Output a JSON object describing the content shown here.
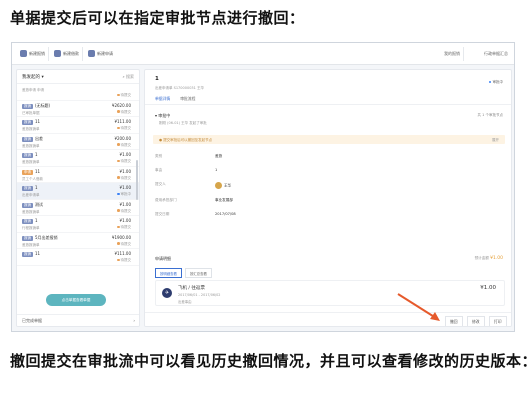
{
  "headings": {
    "top": "单据提交后可以在指定审批节点进行撤回：",
    "bottom": "撤回提交在审批流中可以看见历史撤回情况，并且可以查看修改的历史版本："
  },
  "topbar": {
    "buttons": [
      "新建报销",
      "新建借款",
      "新建申请"
    ],
    "right_items": [
      "我的报销",
      "行政单据汇总"
    ]
  },
  "left_panel": {
    "header": "我发起的",
    "search": "搜索",
    "rows": [
      {
        "badge": "",
        "title": "",
        "sub": "差旅申请 申请",
        "amount": "",
        "status": "待提交",
        "status_color": "orange"
      },
      {
        "badge": "报销",
        "title": "(无标题)",
        "sub": "已审批单据",
        "amount": "¥2620.00",
        "status": "待提交",
        "status_color": "orange"
      },
      {
        "badge": "报销",
        "title": "11",
        "sub": "差旅报销单",
        "amount": "¥111.00",
        "status": "待提交",
        "status_color": "orange"
      },
      {
        "badge": "报销",
        "title": "出差",
        "sub": "差旅报销单",
        "amount": "¥200.00",
        "status": "待提交",
        "status_color": "orange"
      },
      {
        "badge": "报销",
        "title": "1",
        "sub": "差旅报销单",
        "amount": "¥1.00",
        "status": "待提交",
        "status_color": "orange"
      },
      {
        "badge": "申请",
        "title": "11",
        "sub": "员工个人借款",
        "amount": "¥1.00",
        "status": "待提交",
        "status_color": "orange",
        "badge_color": "orange"
      },
      {
        "badge": "报销",
        "title": "1",
        "sub": "出差申请单",
        "amount": "¥1.00",
        "status": "审批中",
        "status_color": "blue",
        "selected": true
      },
      {
        "badge": "报销",
        "title": "测试",
        "sub": "差旅报销单",
        "amount": "¥1.00",
        "status": "待提交",
        "status_color": "orange"
      },
      {
        "badge": "报销",
        "title": "1",
        "sub": "行程报销单",
        "amount": "¥1.00",
        "status": "待提交",
        "status_color": "orange"
      },
      {
        "badge": "报销",
        "title": "5月出差报销",
        "sub": "差旅报销单",
        "amount": "¥1900.00",
        "status": "待提交",
        "status_color": "orange"
      },
      {
        "badge": "报销",
        "title": "11",
        "sub": "",
        "amount": "¥111.00",
        "status": "待提交",
        "status_color": "orange"
      }
    ],
    "footer": "已完成单据",
    "tip": "点击单据查看单据"
  },
  "detail": {
    "title": "1",
    "meta": "出差申请单   S170000031   王华",
    "status": "审批中",
    "tabs": [
      "单据详情",
      "审批流程"
    ],
    "flow_title": "审批中",
    "flow_sub": "刚刚 (06-01) 王华 发起了审批",
    "flow_right": "共 1 个审批节点",
    "notice": "提交审批后可以撤回至发起节点",
    "notice_right": "展开",
    "fields": [
      {
        "k": "类别",
        "v": "差旅"
      },
      {
        "k": "事由",
        "v": "1"
      },
      {
        "k": "提交人",
        "v": "王华"
      },
      {
        "k": "费用承担部门",
        "v": "事业发展部"
      },
      {
        "k": "提交日期",
        "v": "2017/07/08"
      }
    ],
    "detail_head": "申请明细",
    "detail_right_label": "预计金额",
    "detail_right_amount": "¥1.00",
    "subtabs": [
      "按明细查看",
      "按汇总查看"
    ],
    "item": {
      "name": "飞机 / 往返票",
      "d1": "2017/06/01 - 2017/06/02",
      "d2": "出差事由",
      "amount": "¥1.00"
    },
    "actions": [
      "撤回",
      "修改",
      "打印"
    ]
  },
  "colors": {
    "arrow": "#e65a2c",
    "accent": "#3b6fd1",
    "tip": "#5db5bf"
  }
}
